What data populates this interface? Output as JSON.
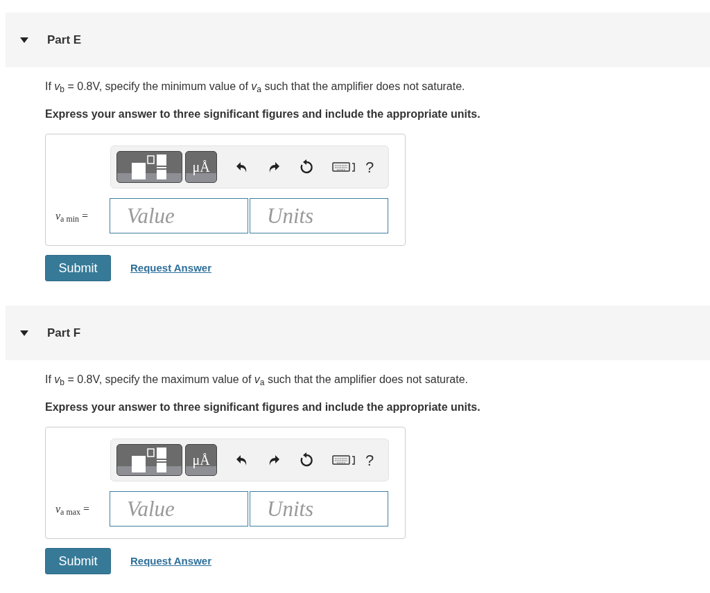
{
  "parts": [
    {
      "title": "Part E",
      "expanded": true,
      "question": "If *v*$_{b}$ = 0.8V, specify the minimum value of *v*$_{a}$ such that the amplifier does not saturate.",
      "instruction": "Express your answer to three significant figures and include the appropriate units.",
      "units_button": "μÅ",
      "help": "?",
      "answer_label": "*v*$_{a min}$ =",
      "value_placeholder": "Value",
      "units_placeholder": "Units",
      "submit": "Submit",
      "request": "Request Answer"
    },
    {
      "title": "Part F",
      "expanded": true,
      "question": "If *v*$_{b}$ = 0.8V, specify the maximum value of *v*$_{a}$ such that the amplifier does not saturate.",
      "instruction": "Express your answer to three significant figures and include the appropriate units.",
      "units_button": "μÅ",
      "help": "?",
      "answer_label": "*v*$_{a max}$ =",
      "value_placeholder": "Value",
      "units_placeholder": "Units",
      "submit": "Submit",
      "request": "Request Answer"
    }
  ]
}
